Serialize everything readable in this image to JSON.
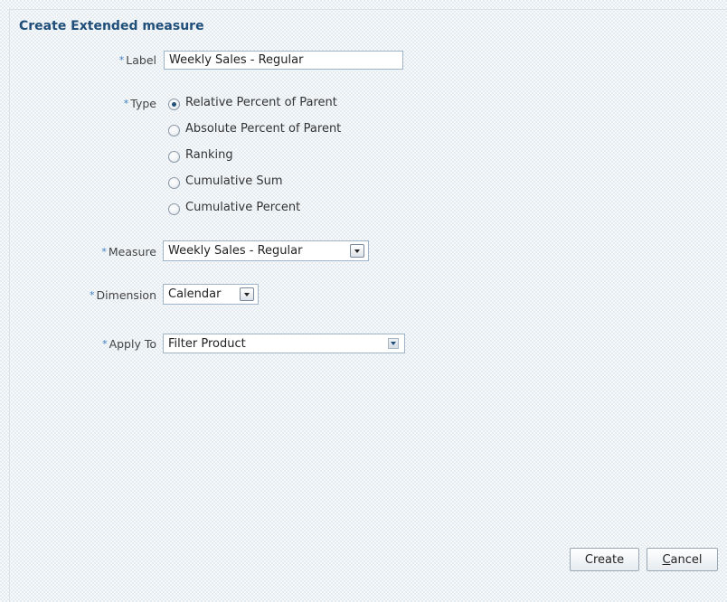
{
  "dialog": {
    "title": "Create Extended measure",
    "required_marker": "*"
  },
  "label_field": {
    "label": "Label",
    "value": "Weekly Sales - Regular"
  },
  "type_field": {
    "label": "Type",
    "options": [
      {
        "label": "Relative Percent of Parent",
        "checked": true
      },
      {
        "label": "Absolute Percent of Parent",
        "checked": false
      },
      {
        "label": "Ranking",
        "checked": false
      },
      {
        "label": "Cumulative Sum",
        "checked": false
      },
      {
        "label": "Cumulative Percent",
        "checked": false
      }
    ]
  },
  "measure_field": {
    "label": "Measure",
    "value": "Weekly Sales - Regular"
  },
  "dimension_field": {
    "label": "Dimension",
    "value": "Calendar"
  },
  "apply_to_field": {
    "label": "Apply To",
    "value": "Filter Product"
  },
  "buttons": {
    "create": "Create",
    "cancel_mnemonic": "C",
    "cancel_rest": "ancel"
  },
  "colors": {
    "title": "#1f4e79",
    "required_marker": "#3f7fbf",
    "field_border": "#9eb3c8"
  }
}
